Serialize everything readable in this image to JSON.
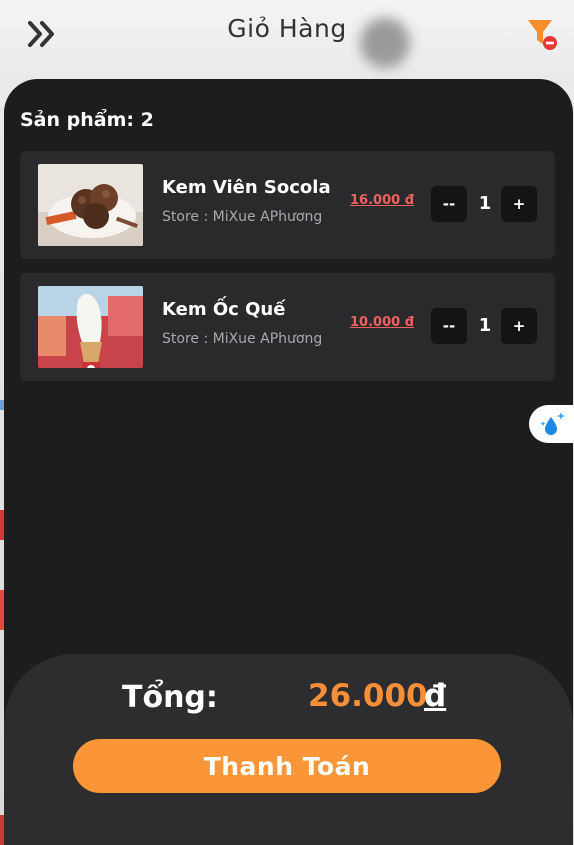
{
  "header": {
    "title": "Giỏ Hàng",
    "back_icon": "double-chevron-right-icon",
    "filter_icon": "filter-remove-icon"
  },
  "cart": {
    "count_label": "Sản phẩm: 2",
    "items": [
      {
        "name": "Kem Viên Socola",
        "store": "Store : MiXue APhương",
        "price": "16.000 đ",
        "quantity": "1",
        "minus_label": "--",
        "plus_label": "+",
        "image_icon": "chocolate-ice-cream-scoops-image"
      },
      {
        "name": "Kem Ốc Quế",
        "store": "Store : MiXue APhương",
        "price": "10.000 đ",
        "quantity": "1",
        "minus_label": "--",
        "plus_label": "+",
        "image_icon": "soft-serve-cone-image"
      }
    ]
  },
  "floating": {
    "icon": "water-drop-sparkle-icon"
  },
  "footer": {
    "total_label": "Tổng:",
    "total_value": "26.000",
    "currency": "đ",
    "pay_label": "Thanh Toán"
  },
  "colors": {
    "panel": "#1d1d1f",
    "card": "#2a2a2c",
    "price": "#f0605d",
    "accent": "#fa9538",
    "total": "#f78e38"
  }
}
